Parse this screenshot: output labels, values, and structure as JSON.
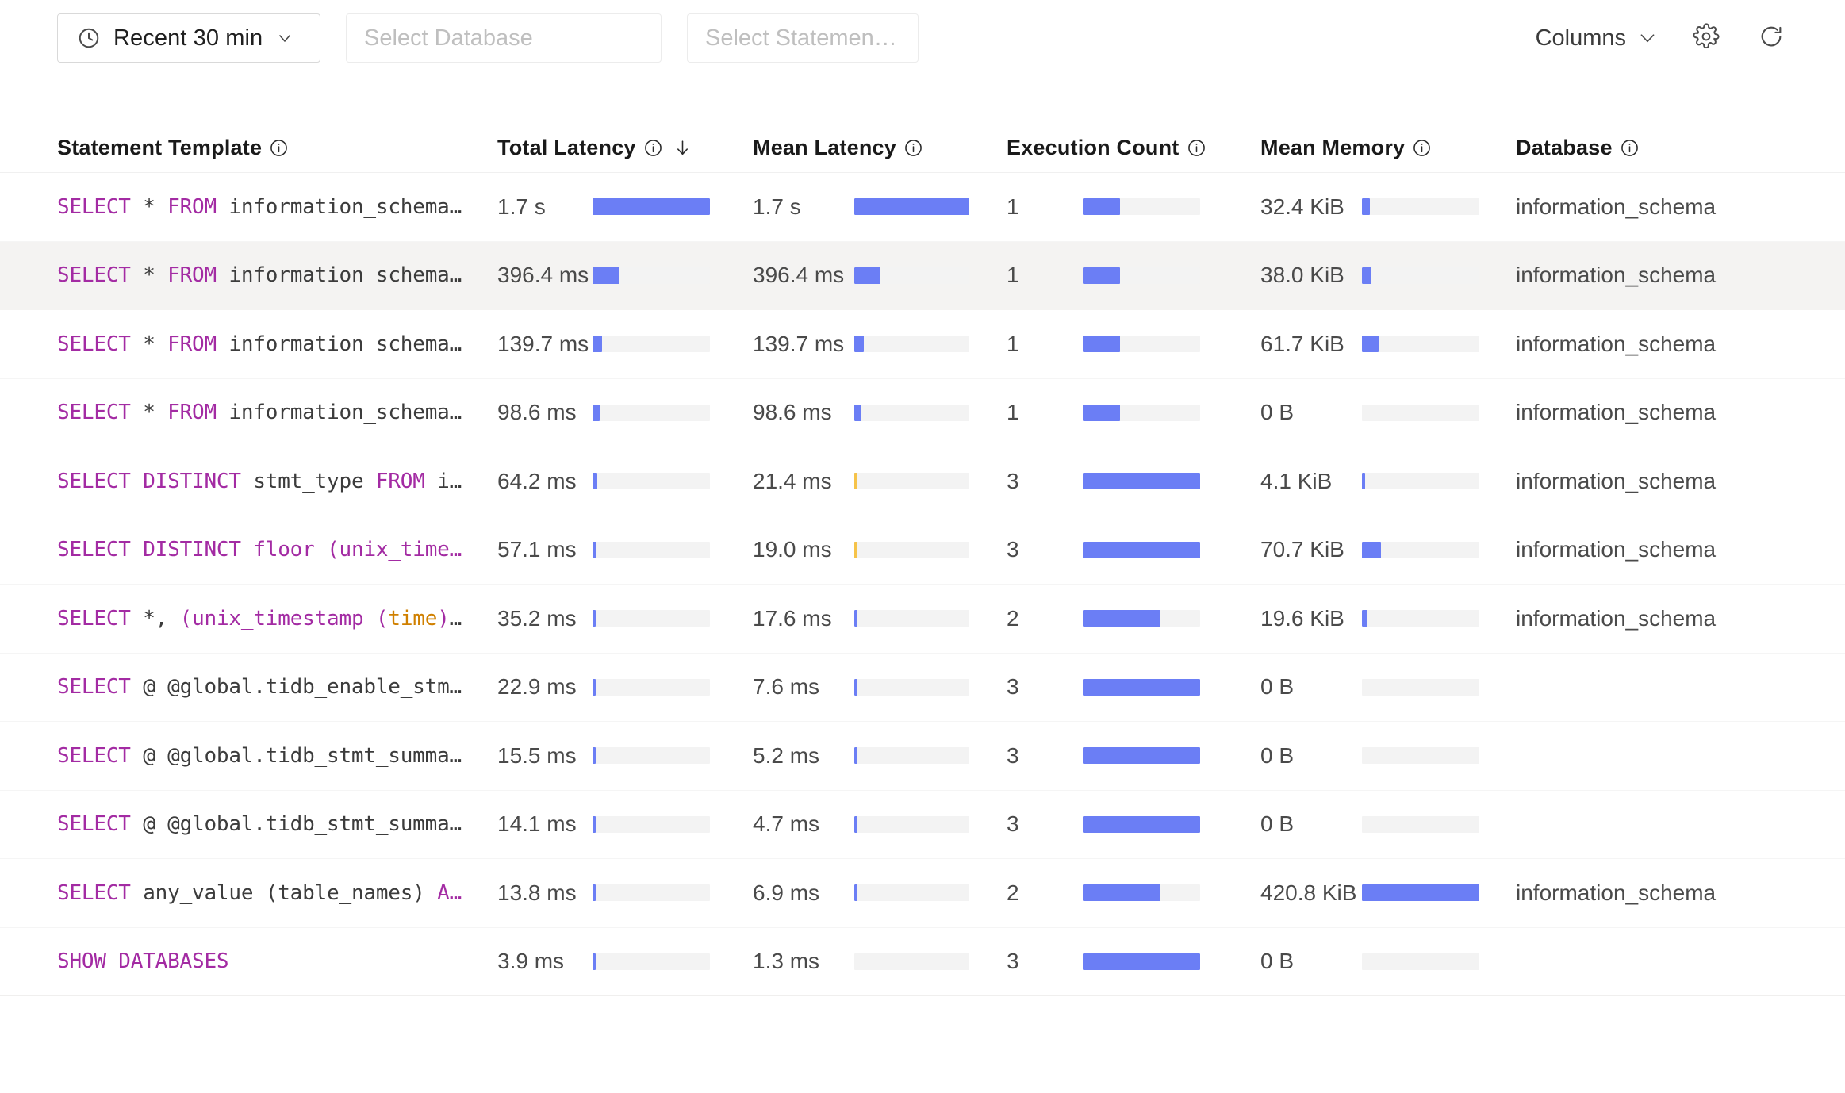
{
  "toolbar": {
    "time_range": {
      "label": "Recent 30 min",
      "icon": "clock-icon",
      "chevron": "chevron-down-icon"
    },
    "database_select": {
      "placeholder": "Select Database",
      "value": ""
    },
    "statement_kind_select": {
      "placeholder": "Select Statement K...",
      "value": ""
    },
    "columns_button": {
      "label": "Columns",
      "chevron": "chevron-down-icon"
    },
    "settings_icon": "gear-icon",
    "refresh_icon": "refresh-icon"
  },
  "table": {
    "columns": [
      {
        "key": "statement",
        "label": "Statement Template",
        "info": true,
        "sorted": false
      },
      {
        "key": "total_latency",
        "label": "Total Latency",
        "info": true,
        "sorted": true,
        "sort_dir": "desc"
      },
      {
        "key": "mean_latency",
        "label": "Mean Latency",
        "info": true,
        "sorted": false
      },
      {
        "key": "exec_count",
        "label": "Execution Count",
        "info": true,
        "sorted": false
      },
      {
        "key": "mean_memory",
        "label": "Mean Memory",
        "info": true,
        "sorted": false
      },
      {
        "key": "database",
        "label": "Database",
        "info": true,
        "sorted": false
      }
    ],
    "rows": [
      {
        "sql_tokens": [
          {
            "t": "SELECT",
            "c": "kw"
          },
          {
            "t": " ",
            "c": "id"
          },
          {
            "t": "*",
            "c": "id"
          },
          {
            "t": " ",
            "c": "id"
          },
          {
            "t": "FROM",
            "c": "kw"
          },
          {
            "t": " ",
            "c": "id"
          },
          {
            "t": "information_schema…",
            "c": "id"
          }
        ],
        "total_latency": "1.7 s",
        "total_latency_pct": 100,
        "mean_latency": "1.7 s",
        "mean_latency_pct": 100,
        "mean_latency_overlay_pct": 0,
        "exec_count": "1",
        "exec_count_pct": 32,
        "mean_memory": "32.4 KiB",
        "mean_memory_pct": 7,
        "database": "information_schema",
        "highlighted": false
      },
      {
        "sql_tokens": [
          {
            "t": "SELECT",
            "c": "kw"
          },
          {
            "t": " ",
            "c": "id"
          },
          {
            "t": "*",
            "c": "id"
          },
          {
            "t": " ",
            "c": "id"
          },
          {
            "t": "FROM",
            "c": "kw"
          },
          {
            "t": " ",
            "c": "id"
          },
          {
            "t": "information_schema…",
            "c": "id"
          }
        ],
        "total_latency": "396.4 ms",
        "total_latency_pct": 23,
        "mean_latency": "396.4 ms",
        "mean_latency_pct": 23,
        "mean_latency_overlay_pct": 0,
        "exec_count": "1",
        "exec_count_pct": 32,
        "mean_memory": "38.0 KiB",
        "mean_memory_pct": 8,
        "database": "information_schema",
        "highlighted": true
      },
      {
        "sql_tokens": [
          {
            "t": "SELECT",
            "c": "kw"
          },
          {
            "t": " ",
            "c": "id"
          },
          {
            "t": "*",
            "c": "id"
          },
          {
            "t": " ",
            "c": "id"
          },
          {
            "t": "FROM",
            "c": "kw"
          },
          {
            "t": " ",
            "c": "id"
          },
          {
            "t": "information_schema…",
            "c": "id"
          }
        ],
        "total_latency": "139.7 ms",
        "total_latency_pct": 8,
        "mean_latency": "139.7 ms",
        "mean_latency_pct": 8,
        "mean_latency_overlay_pct": 0,
        "exec_count": "1",
        "exec_count_pct": 32,
        "mean_memory": "61.7 KiB",
        "mean_memory_pct": 14,
        "database": "information_schema",
        "highlighted": false
      },
      {
        "sql_tokens": [
          {
            "t": "SELECT",
            "c": "kw"
          },
          {
            "t": " ",
            "c": "id"
          },
          {
            "t": "*",
            "c": "id"
          },
          {
            "t": " ",
            "c": "id"
          },
          {
            "t": "FROM",
            "c": "kw"
          },
          {
            "t": " ",
            "c": "id"
          },
          {
            "t": "information_schema…",
            "c": "id"
          }
        ],
        "total_latency": "98.6 ms",
        "total_latency_pct": 6,
        "mean_latency": "98.6 ms",
        "mean_latency_pct": 6,
        "mean_latency_overlay_pct": 0,
        "exec_count": "1",
        "exec_count_pct": 32,
        "mean_memory": "0 B",
        "mean_memory_pct": 0,
        "database": "information_schema",
        "highlighted": false
      },
      {
        "sql_tokens": [
          {
            "t": "SELECT",
            "c": "kw"
          },
          {
            "t": " ",
            "c": "id"
          },
          {
            "t": "DISTINCT",
            "c": "kw"
          },
          {
            "t": " ",
            "c": "id"
          },
          {
            "t": "stmt_type",
            "c": "id"
          },
          {
            "t": " ",
            "c": "id"
          },
          {
            "t": "FROM",
            "c": "kw"
          },
          {
            "t": " ",
            "c": "id"
          },
          {
            "t": "i…",
            "c": "id"
          }
        ],
        "total_latency": "64.2 ms",
        "total_latency_pct": 4,
        "mean_latency": "21.4 ms",
        "mean_latency_pct": 1.3,
        "mean_latency_overlay_pct": 3,
        "exec_count": "3",
        "exec_count_pct": 100,
        "mean_memory": "4.1 KiB",
        "mean_memory_pct": 1,
        "database": "information_schema",
        "highlighted": false
      },
      {
        "sql_tokens": [
          {
            "t": "SELECT",
            "c": "kw"
          },
          {
            "t": " ",
            "c": "id"
          },
          {
            "t": "DISTINCT",
            "c": "kw"
          },
          {
            "t": " ",
            "c": "id"
          },
          {
            "t": "floor",
            "c": "fn"
          },
          {
            "t": " ",
            "c": "id"
          },
          {
            "t": "(",
            "c": "punc"
          },
          {
            "t": "unix_time…",
            "c": "fn"
          }
        ],
        "total_latency": "57.1 ms",
        "total_latency_pct": 3.4,
        "mean_latency": "19.0 ms",
        "mean_latency_pct": 1.2,
        "mean_latency_overlay_pct": 3,
        "exec_count": "3",
        "exec_count_pct": 100,
        "mean_memory": "70.7 KiB",
        "mean_memory_pct": 16,
        "database": "information_schema",
        "highlighted": false
      },
      {
        "sql_tokens": [
          {
            "t": "SELECT",
            "c": "kw"
          },
          {
            "t": " ",
            "c": "id"
          },
          {
            "t": "*,",
            "c": "id"
          },
          {
            "t": " ",
            "c": "id"
          },
          {
            "t": "(",
            "c": "punc"
          },
          {
            "t": "unix_timestamp",
            "c": "fn"
          },
          {
            "t": " ",
            "c": "id"
          },
          {
            "t": "(",
            "c": "punc"
          },
          {
            "t": "time",
            "c": "col"
          },
          {
            "t": ")",
            "c": "punc"
          },
          {
            "t": "…",
            "c": "id"
          }
        ],
        "total_latency": "35.2 ms",
        "total_latency_pct": 2.1,
        "mean_latency": "17.6 ms",
        "mean_latency_pct": 1.1,
        "mean_latency_overlay_pct": 0,
        "exec_count": "2",
        "exec_count_pct": 66,
        "mean_memory": "19.6 KiB",
        "mean_memory_pct": 4.5,
        "database": "information_schema",
        "highlighted": false
      },
      {
        "sql_tokens": [
          {
            "t": "SELECT",
            "c": "kw"
          },
          {
            "t": " ",
            "c": "id"
          },
          {
            "t": "@ @global.tidb_enable_stm…",
            "c": "id"
          }
        ],
        "total_latency": "22.9 ms",
        "total_latency_pct": 1.4,
        "mean_latency": "7.6 ms",
        "mean_latency_pct": 0.5,
        "mean_latency_overlay_pct": 0,
        "exec_count": "3",
        "exec_count_pct": 100,
        "mean_memory": "0 B",
        "mean_memory_pct": 0,
        "database": "",
        "highlighted": false
      },
      {
        "sql_tokens": [
          {
            "t": "SELECT",
            "c": "kw"
          },
          {
            "t": " ",
            "c": "id"
          },
          {
            "t": "@ @global.tidb_stmt_summa…",
            "c": "id"
          }
        ],
        "total_latency": "15.5 ms",
        "total_latency_pct": 1,
        "mean_latency": "5.2 ms",
        "mean_latency_pct": 0.4,
        "mean_latency_overlay_pct": 0,
        "exec_count": "3",
        "exec_count_pct": 100,
        "mean_memory": "0 B",
        "mean_memory_pct": 0,
        "database": "",
        "highlighted": false
      },
      {
        "sql_tokens": [
          {
            "t": "SELECT",
            "c": "kw"
          },
          {
            "t": " ",
            "c": "id"
          },
          {
            "t": "@ @global.tidb_stmt_summa…",
            "c": "id"
          }
        ],
        "total_latency": "14.1 ms",
        "total_latency_pct": 0.9,
        "mean_latency": "4.7 ms",
        "mean_latency_pct": 0.4,
        "mean_latency_overlay_pct": 0,
        "exec_count": "3",
        "exec_count_pct": 100,
        "mean_memory": "0 B",
        "mean_memory_pct": 0,
        "database": "",
        "highlighted": false
      },
      {
        "sql_tokens": [
          {
            "t": "SELECT",
            "c": "kw"
          },
          {
            "t": " ",
            "c": "id"
          },
          {
            "t": "any_value",
            "c": "id"
          },
          {
            "t": " ",
            "c": "id"
          },
          {
            "t": "(table_names)",
            "c": "id"
          },
          {
            "t": " ",
            "c": "id"
          },
          {
            "t": "A…",
            "c": "kw"
          }
        ],
        "total_latency": "13.8 ms",
        "total_latency_pct": 0.9,
        "mean_latency": "6.9 ms",
        "mean_latency_pct": 0.5,
        "mean_latency_overlay_pct": 0,
        "exec_count": "2",
        "exec_count_pct": 66,
        "mean_memory": "420.8 KiB",
        "mean_memory_pct": 100,
        "database": "information_schema",
        "highlighted": false
      },
      {
        "sql_tokens": [
          {
            "t": "SHOW DATABASES",
            "c": "kw"
          }
        ],
        "total_latency": "3.9 ms",
        "total_latency_pct": 0.4,
        "mean_latency": "1.3 ms",
        "mean_latency_pct": 0,
        "mean_latency_overlay_pct": 0,
        "exec_count": "3",
        "exec_count_pct": 100,
        "mean_memory": "0 B",
        "mean_memory_pct": 0,
        "database": "",
        "highlighted": false
      }
    ]
  },
  "colors": {
    "bar_fill": "#6b7ef5",
    "bar_overlay": "#f6c349",
    "bar_track": "#f3f3f3",
    "sql_keyword": "#a32ba3",
    "sql_column": "#d08000",
    "row_highlight": "#f4f3f2"
  }
}
